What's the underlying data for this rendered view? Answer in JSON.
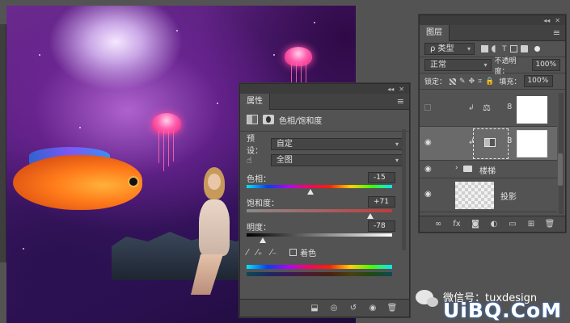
{
  "properties_panel": {
    "collapse_glyph": "◂◂",
    "close_glyph": "✕",
    "tab_label": "属性",
    "adjustment_title": "色相/饱和度",
    "preset_label": "预设：",
    "preset_value": "自定",
    "channel_value": "全图",
    "hue": {
      "label": "色相：",
      "value": "-15",
      "fraction": 0.44
    },
    "saturation": {
      "label": "饱和度：",
      "value": "+71",
      "fraction": 0.85
    },
    "lightness": {
      "label": "明度：",
      "value": "-78",
      "fraction": 0.11
    },
    "colorize_label": "着色",
    "colorize_checked": false
  },
  "layers_panel": {
    "collapse_glyph": "◂◂",
    "close_glyph": "✕",
    "tab_label": "图层",
    "filter_label": "ρ 类型",
    "blend_mode": "正常",
    "opacity_label": "不透明度：",
    "opacity_value": "100%",
    "lock_label": "锁定：",
    "fill_label": "填充：",
    "fill_value": "100%",
    "layers": [
      {
        "type": "adjustment-levels",
        "name": "",
        "visible": false
      },
      {
        "type": "adjustment-hue-saturation",
        "name": "",
        "visible": true,
        "selected": true
      },
      {
        "type": "group",
        "name": "楼梯",
        "visible": true
      },
      {
        "type": "layer",
        "name": "投影",
        "visible": true
      }
    ]
  },
  "watermark": {
    "wechat_text": "微信号：tuxdesign",
    "site_text": "UiBQ.CoM"
  },
  "icons": {
    "eye": "eye-icon",
    "menu": "panel-menu-icon",
    "link": "link-icon",
    "folder": "folder-icon",
    "hand": "target-adjust-icon"
  },
  "colors": {
    "panel_bg": "#535353",
    "panel_dark": "#424242",
    "accent_text": "#e0e0e0"
  }
}
